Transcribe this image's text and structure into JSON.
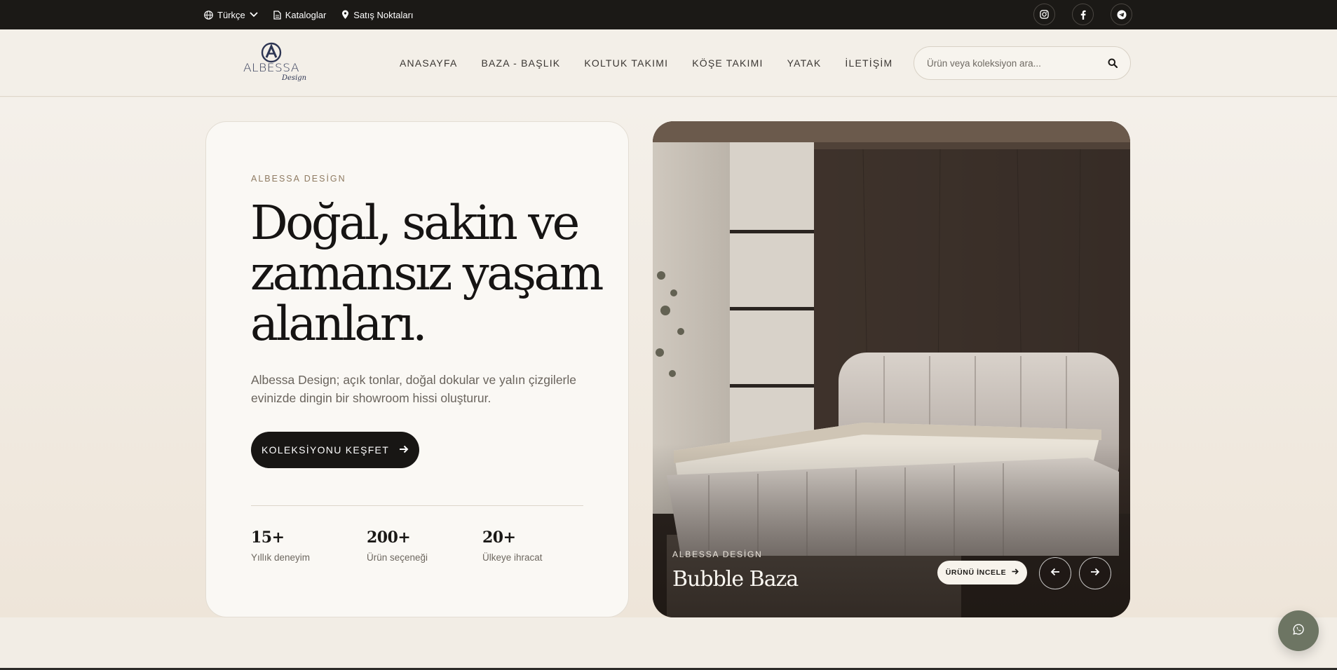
{
  "topbar": {
    "language": "Türkçe",
    "catalogs": "Kataloglar",
    "stores": "Satış Noktaları",
    "socials": [
      "instagram-icon",
      "facebook-icon",
      "telegram-icon"
    ]
  },
  "header": {
    "logo_word": "ALBESSA",
    "logo_sub": "Design",
    "nav": [
      "ANASAYFA",
      "BAZA - BAŞLIK",
      "KOLTUK TAKIMI",
      "KÖŞE TAKIMI",
      "YATAK",
      "İLETİŞİM"
    ],
    "search_placeholder": "Ürün veya koleksiyon ara..."
  },
  "hero": {
    "eyebrow": "ALBESSA DESİGN",
    "headline_line1": "Doğal, sakin ve",
    "headline_line2": "zamansız yaşam",
    "headline_line3": "alanları.",
    "description": "Albessa Design; açık tonlar, doğal dokular ve yalın çizgilerle evinizde dingin bir showroom hissi oluşturur.",
    "cta": "KOLEKSİYONU KEŞFET",
    "stats": [
      {
        "value": "15+",
        "label": "Yıllık deneyim"
      },
      {
        "value": "200+",
        "label": "Ürün seçeneği"
      },
      {
        "value": "20+",
        "label": "Ülkeye ihracat"
      }
    ]
  },
  "slide": {
    "eyebrow": "ALBESSA DESİGN",
    "title": "Bubble Baza",
    "inspect": "ÜRÜNÜ İNCELE"
  },
  "colors": {
    "dark": "#1b1916",
    "cream": "#faf8f4",
    "accent_brown": "#8f7b62",
    "whatsapp": "#6d7563"
  }
}
